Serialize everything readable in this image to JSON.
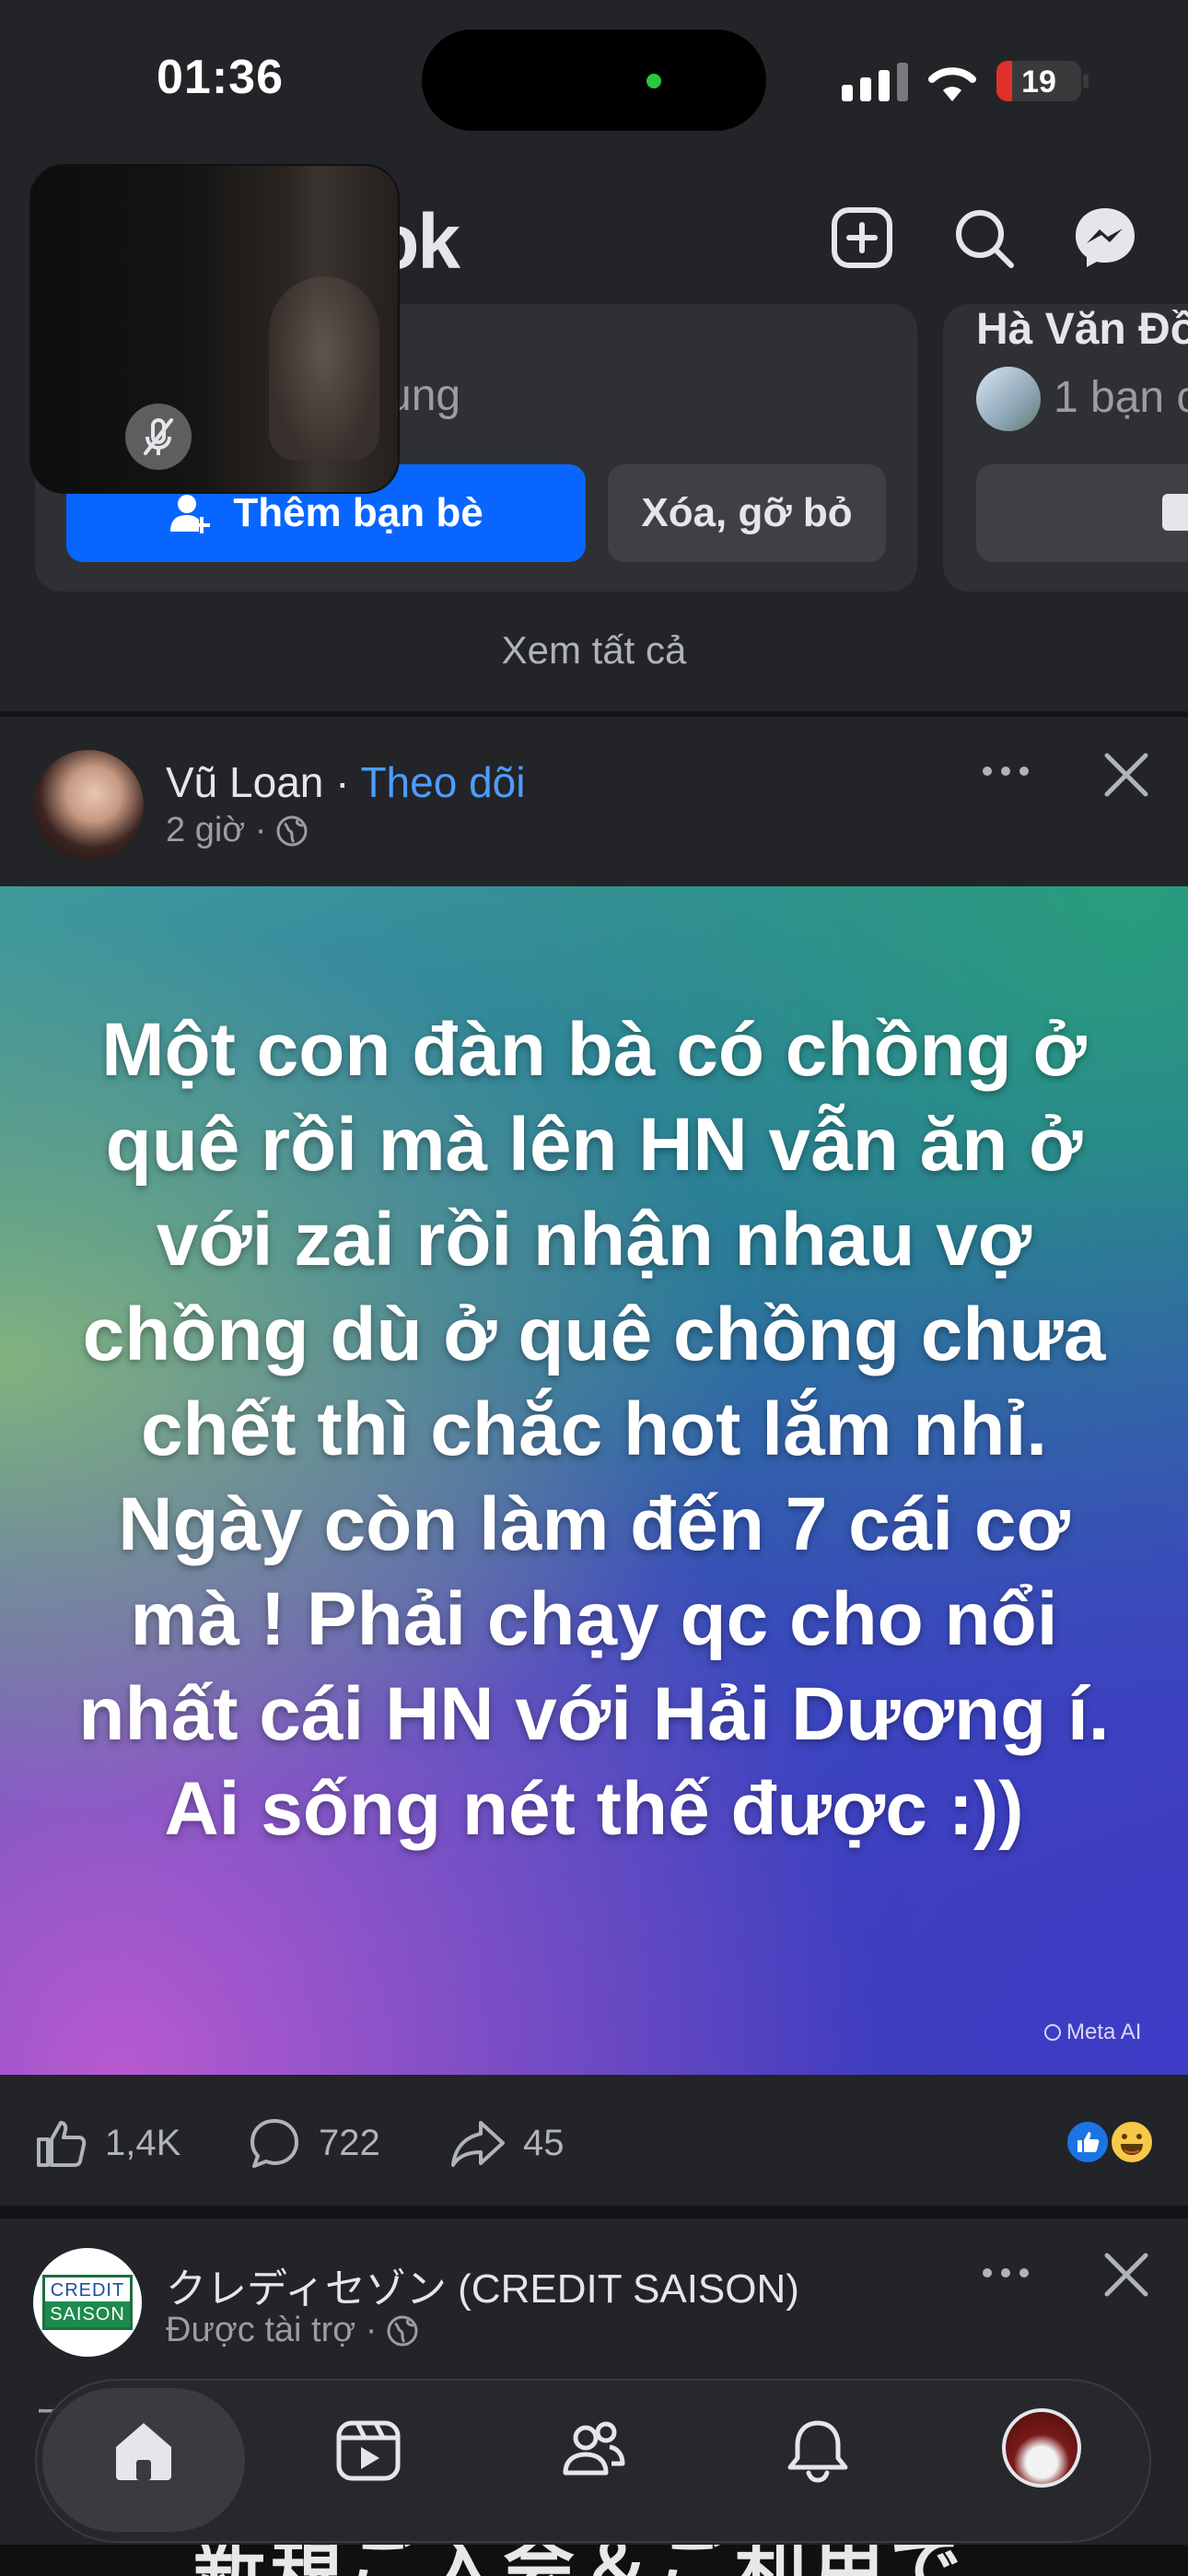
{
  "status_bar": {
    "time": "01:36",
    "battery": "19",
    "battery_level": 0.19
  },
  "header": {
    "logo_partial": "ok",
    "icons": [
      "add-icon",
      "search-icon",
      "messenger-icon"
    ]
  },
  "suggestions": {
    "card1": {
      "mutual_partial": "ung",
      "add_button": "Thêm bạn bè",
      "remove_button": "Xóa, gỡ bỏ"
    },
    "card2": {
      "name": "Hà Văn Đồ",
      "mutual": "1 bạn c"
    },
    "see_all": "Xem tất cả"
  },
  "post1": {
    "author": "Vũ Loan",
    "separator": " · ",
    "follow": "Theo dõi",
    "time": "2 giờ ·",
    "content": "Một con đàn bà có chồng ở quê rồi mà lên HN vẫn ăn ở với zai rồi nhận nhau vợ chồng dù ở quê chồng chưa chết thì chắc hot lắm nhỉ. Ngày còn làm đến 7 cái cơ mà ! Phải chạy qc cho nổi nhất cái HN với Hải Dương í. Ai sống nét thế được :))",
    "watermark": "Meta AI",
    "likes": "1,4K",
    "comments": "722",
    "shares": "45"
  },
  "post2": {
    "author": "クレディセゾン (CREDIT SAISON)",
    "sponsored": "Được tài trợ ·",
    "logo_top": "CREDIT",
    "logo_bottom": "SAISON",
    "peek": "ー",
    "banner_text": "新規ご入会＆ご利用で"
  },
  "bottom_nav": {
    "items": [
      "home-icon",
      "video-icon",
      "friends-icon",
      "notifications-icon",
      "profile-avatar"
    ]
  }
}
